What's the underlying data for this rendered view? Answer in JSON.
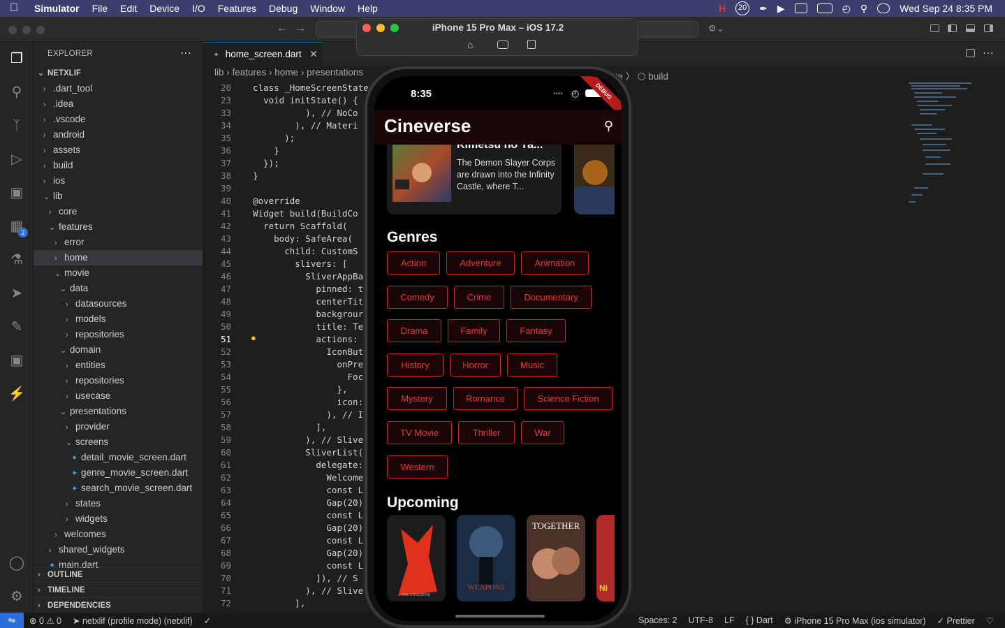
{
  "menubar": {
    "app": "Simulator",
    "items": [
      "File",
      "Edit",
      "Device",
      "I/O",
      "Features",
      "Debug",
      "Window",
      "Help"
    ],
    "clock": "Wed Sep 24  8:35 PM",
    "badge_count": "20"
  },
  "sim_window": {
    "title": "iPhone 15 Pro Max – iOS 17.2"
  },
  "explorer": {
    "header": "EXPLORER",
    "root": "NETXLIF",
    "rows": [
      {
        "label": ".dart_tool",
        "depth": 1,
        "type": "folder",
        "open": false
      },
      {
        "label": ".idea",
        "depth": 1,
        "type": "folder",
        "open": false
      },
      {
        "label": ".vscode",
        "depth": 1,
        "type": "folder",
        "open": false
      },
      {
        "label": "android",
        "depth": 1,
        "type": "folder",
        "open": false
      },
      {
        "label": "assets",
        "depth": 1,
        "type": "folder",
        "open": false
      },
      {
        "label": "build",
        "depth": 1,
        "type": "folder",
        "open": false
      },
      {
        "label": "ios",
        "depth": 1,
        "type": "folder",
        "open": false
      },
      {
        "label": "lib",
        "depth": 1,
        "type": "folder",
        "open": true
      },
      {
        "label": "core",
        "depth": 2,
        "type": "folder",
        "open": false
      },
      {
        "label": "features",
        "depth": 2,
        "type": "folder",
        "open": true
      },
      {
        "label": "error",
        "depth": 3,
        "type": "folder",
        "open": false
      },
      {
        "label": "home",
        "depth": 3,
        "type": "folder",
        "open": false,
        "selected": true
      },
      {
        "label": "movie",
        "depth": 3,
        "type": "folder",
        "open": true
      },
      {
        "label": "data",
        "depth": 4,
        "type": "folder",
        "open": true
      },
      {
        "label": "datasources",
        "depth": 5,
        "type": "folder",
        "open": false
      },
      {
        "label": "models",
        "depth": 5,
        "type": "folder",
        "open": false
      },
      {
        "label": "repositories",
        "depth": 5,
        "type": "folder",
        "open": false
      },
      {
        "label": "domain",
        "depth": 4,
        "type": "folder",
        "open": true
      },
      {
        "label": "entities",
        "depth": 5,
        "type": "folder",
        "open": false
      },
      {
        "label": "repositories",
        "depth": 5,
        "type": "folder",
        "open": false
      },
      {
        "label": "usecase",
        "depth": 5,
        "type": "folder",
        "open": false
      },
      {
        "label": "presentations",
        "depth": 4,
        "type": "folder",
        "open": true
      },
      {
        "label": "provider",
        "depth": 5,
        "type": "folder",
        "open": false
      },
      {
        "label": "screens",
        "depth": 5,
        "type": "folder",
        "open": true
      },
      {
        "label": "detail_movie_screen.dart",
        "depth": 6,
        "type": "file"
      },
      {
        "label": "genre_movie_screen.dart",
        "depth": 6,
        "type": "file"
      },
      {
        "label": "search_movie_screen.dart",
        "depth": 6,
        "type": "file"
      },
      {
        "label": "states",
        "depth": 5,
        "type": "folder",
        "open": false
      },
      {
        "label": "widgets",
        "depth": 5,
        "type": "folder",
        "open": false
      },
      {
        "label": "welcomes",
        "depth": 3,
        "type": "folder",
        "open": false
      },
      {
        "label": "shared_widgets",
        "depth": 2,
        "type": "folder",
        "open": false
      },
      {
        "label": "main.dart",
        "depth": 2,
        "type": "file"
      }
    ],
    "sections": [
      "OUTLINE",
      "TIMELINE",
      "DEPENDENCIES"
    ]
  },
  "editor": {
    "tab": "home_screen.dart",
    "breadcrumb": [
      "lib",
      "features",
      "home",
      "presentations"
    ],
    "breadcrumb_tail": "ate  〉 ⬡ build",
    "lines": [
      {
        "n": "20",
        "code": "  class _HomeScreenState e"
      },
      {
        "n": "23",
        "code": "    void initState() {"
      },
      {
        "n": "33",
        "code": "            ), // NoCo"
      },
      {
        "n": "34",
        "code": "          ), // Materi"
      },
      {
        "n": "35",
        "code": "        );"
      },
      {
        "n": "36",
        "code": "      }"
      },
      {
        "n": "37",
        "code": "    });"
      },
      {
        "n": "38",
        "code": "  }"
      },
      {
        "n": "39",
        "code": ""
      },
      {
        "n": "40",
        "code": "  @override"
      },
      {
        "n": "41",
        "code": "  Widget build(BuildCo"
      },
      {
        "n": "42",
        "code": "    return Scaffold("
      },
      {
        "n": "43",
        "code": "      body: SafeArea("
      },
      {
        "n": "44",
        "code": "        child: CustomS"
      },
      {
        "n": "45",
        "code": "          slivers: ["
      },
      {
        "n": "46",
        "code": "            SliverAppBa"
      },
      {
        "n": "47",
        "code": "              pinned: t"
      },
      {
        "n": "48",
        "code": "              centerTit"
      },
      {
        "n": "49",
        "code": "              backgrour"
      },
      {
        "n": "50",
        "code": "              title: Te"
      },
      {
        "n": "51",
        "code": "              actions:"
      },
      {
        "n": "52",
        "code": "                IconBut"
      },
      {
        "n": "53",
        "code": "                  onPre"
      },
      {
        "n": "54",
        "code": "                    Foc"
      },
      {
        "n": "55",
        "code": "                  },"
      },
      {
        "n": "56",
        "code": "                  icon:"
      },
      {
        "n": "57",
        "code": "                ), // I"
      },
      {
        "n": "58",
        "code": "              ],"
      },
      {
        "n": "59",
        "code": "            ), // Slive"
      },
      {
        "n": "60",
        "code": "            SliverList("
      },
      {
        "n": "61",
        "code": "              delegate:"
      },
      {
        "n": "62",
        "code": "                Welcome"
      },
      {
        "n": "63",
        "code": "                const L"
      },
      {
        "n": "64",
        "code": "                Gap(20)"
      },
      {
        "n": "65",
        "code": "                const L"
      },
      {
        "n": "66",
        "code": "                Gap(20)"
      },
      {
        "n": "67",
        "code": "                const L"
      },
      {
        "n": "68",
        "code": "                Gap(20)"
      },
      {
        "n": "69",
        "code": "                const L"
      },
      {
        "n": "70",
        "code": "              ]), // S"
      },
      {
        "n": "71",
        "code": "            ), // Slive"
      },
      {
        "n": "72",
        "code": "          ],"
      }
    ]
  },
  "statusbar": {
    "problems": "⊗ 0 ⚠ 0",
    "project": "netxlif (profile mode) (netxlif)",
    "spaces": "Spaces: 2",
    "encoding": "UTF-8",
    "eol": "LF",
    "lang": "{ } Dart",
    "device": "iPhone 15 Pro Max (ios simulator)",
    "formatter": "Prettier"
  },
  "app": {
    "status_time": "8:35",
    "debug_banner": "DEBUG",
    "title": "Cineverse",
    "featured": {
      "title": "Kimetsu no Ya...",
      "description": "The Demon Slayer Corps are drawn into the Infinity Castle, where T..."
    },
    "genres_heading": "Genres",
    "genres": [
      "Action",
      "Adventure",
      "Animation",
      "Comedy",
      "Crime",
      "Documentary",
      "Drama",
      "Family",
      "Fantasy",
      "History",
      "Horror",
      "Music",
      "Mystery",
      "Romance",
      "Science Fiction",
      "TV Movie",
      "Thriller",
      "War",
      "Western"
    ],
    "upcoming_heading": "Upcoming",
    "posters": [
      "THE CONJURING",
      "WEAPONS",
      "TOGETHER",
      "NI"
    ]
  }
}
